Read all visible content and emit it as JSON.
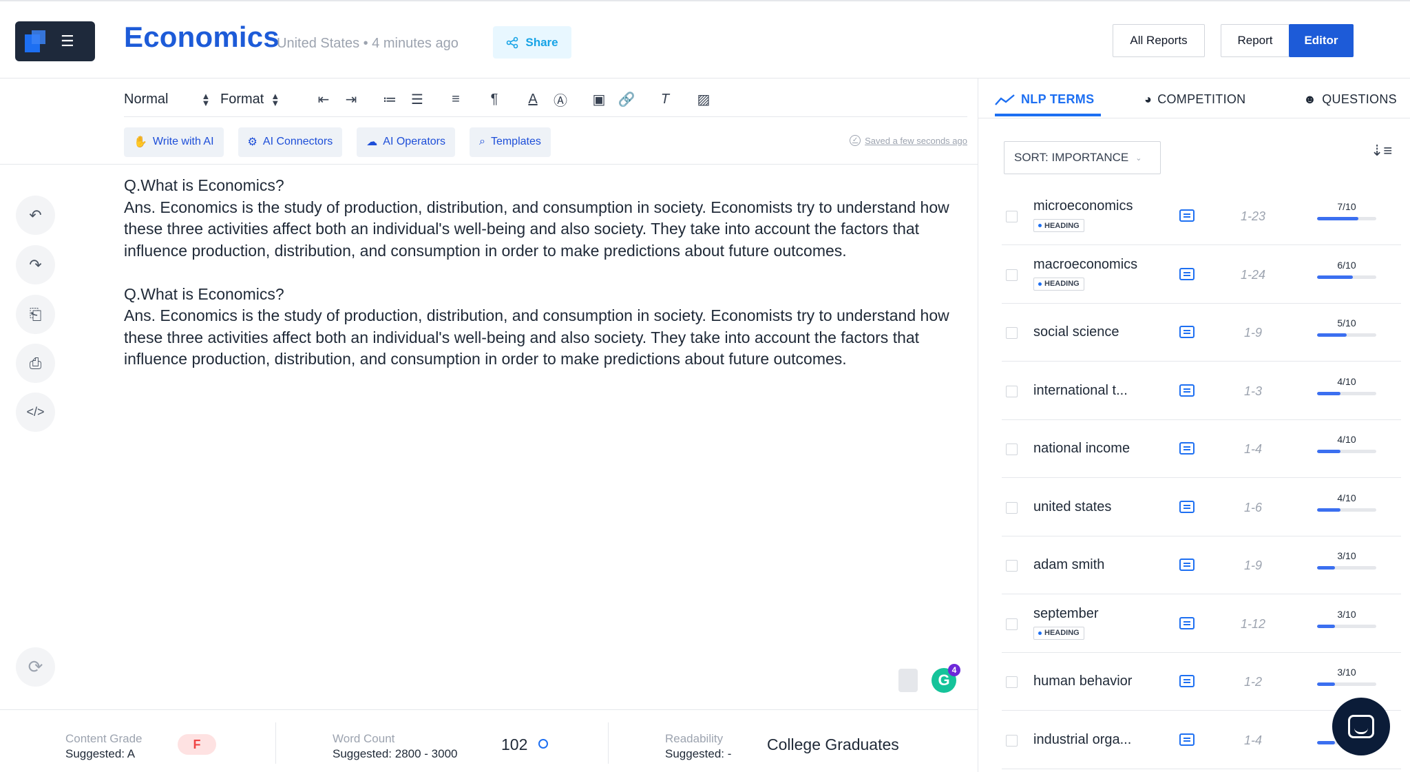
{
  "header": {
    "title": "Economics",
    "subtitle": "United States • 4 minutes ago",
    "share_label": "Share",
    "all_reports_label": "All Reports",
    "report_label": "Report",
    "editor_label": "Editor"
  },
  "toolbar": {
    "block_style": "Normal",
    "format_label": "Format",
    "ai_buttons": [
      "Write with AI",
      "AI Connectors",
      "AI Operators",
      "Templates"
    ],
    "saved_status": "Saved a few seconds ago"
  },
  "content": {
    "paragraphs": [
      "Q.What is Economics?",
      "Ans. Economics is the study of production, distribution, and consumption in society. Economists try to understand how these three activities affect both an individual's well-being and also society. They take into account the factors that influence production, distribution, and consumption in order to make predictions about future outcomes.",
      "Q.What is Economics?",
      "Ans. Economics is the study of production, distribution, and consumption in society. Economists try to understand how these three activities affect both an individual's well-being and also society. They take into account the factors that influence production, distribution, and consumption in order to make predictions about future outcomes."
    ],
    "grammarly_count": "4"
  },
  "metrics": {
    "content_grade_label": "Content Grade",
    "content_grade_suggested": "Suggested: A",
    "content_grade_value": "F",
    "word_count_label": "Word Count",
    "word_count_suggested": "Suggested: 2800 - 3000",
    "word_count_value": "102",
    "readability_label": "Readability",
    "readability_suggested": "Suggested: -",
    "readability_value": "College Graduates"
  },
  "panel": {
    "tabs": [
      "NLP TERMS",
      "COMPETITION",
      "QUESTIONS"
    ],
    "active_tab": "NLP TERMS",
    "sort_label": "SORT: IMPORTANCE",
    "terms": [
      {
        "name": "microeconomics",
        "tag": "HEADING",
        "range": "1-23",
        "score": "7/10",
        "fill": 0.7
      },
      {
        "name": "macroeconomics",
        "tag": "HEADING",
        "range": "1-24",
        "score": "6/10",
        "fill": 0.6
      },
      {
        "name": "social science",
        "tag": "",
        "range": "1-9",
        "score": "5/10",
        "fill": 0.5
      },
      {
        "name": "international t...",
        "tag": "",
        "range": "1-3",
        "score": "4/10",
        "fill": 0.4
      },
      {
        "name": "national income",
        "tag": "",
        "range": "1-4",
        "score": "4/10",
        "fill": 0.4
      },
      {
        "name": "united states",
        "tag": "",
        "range": "1-6",
        "score": "4/10",
        "fill": 0.4
      },
      {
        "name": "adam smith",
        "tag": "",
        "range": "1-9",
        "score": "3/10",
        "fill": 0.3
      },
      {
        "name": "september",
        "tag": "HEADING",
        "range": "1-12",
        "score": "3/10",
        "fill": 0.3
      },
      {
        "name": "human behavior",
        "tag": "",
        "range": "1-2",
        "score": "3/10",
        "fill": 0.3
      },
      {
        "name": "industrial orga...",
        "tag": "",
        "range": "1-4",
        "score": "",
        "fill": 0.3
      }
    ]
  },
  "icons": {
    "share": "share-icon",
    "undo": "undo-icon",
    "redo": "redo-icon",
    "export": "export-icon",
    "pdf": "pdf-icon",
    "code": "code-icon",
    "refresh": "refresh-icon",
    "chat": "chat-icon"
  },
  "colors": {
    "brand": "#1d5bd8",
    "accent": "#1d6ff2",
    "grade_bad": "#ef4444"
  }
}
